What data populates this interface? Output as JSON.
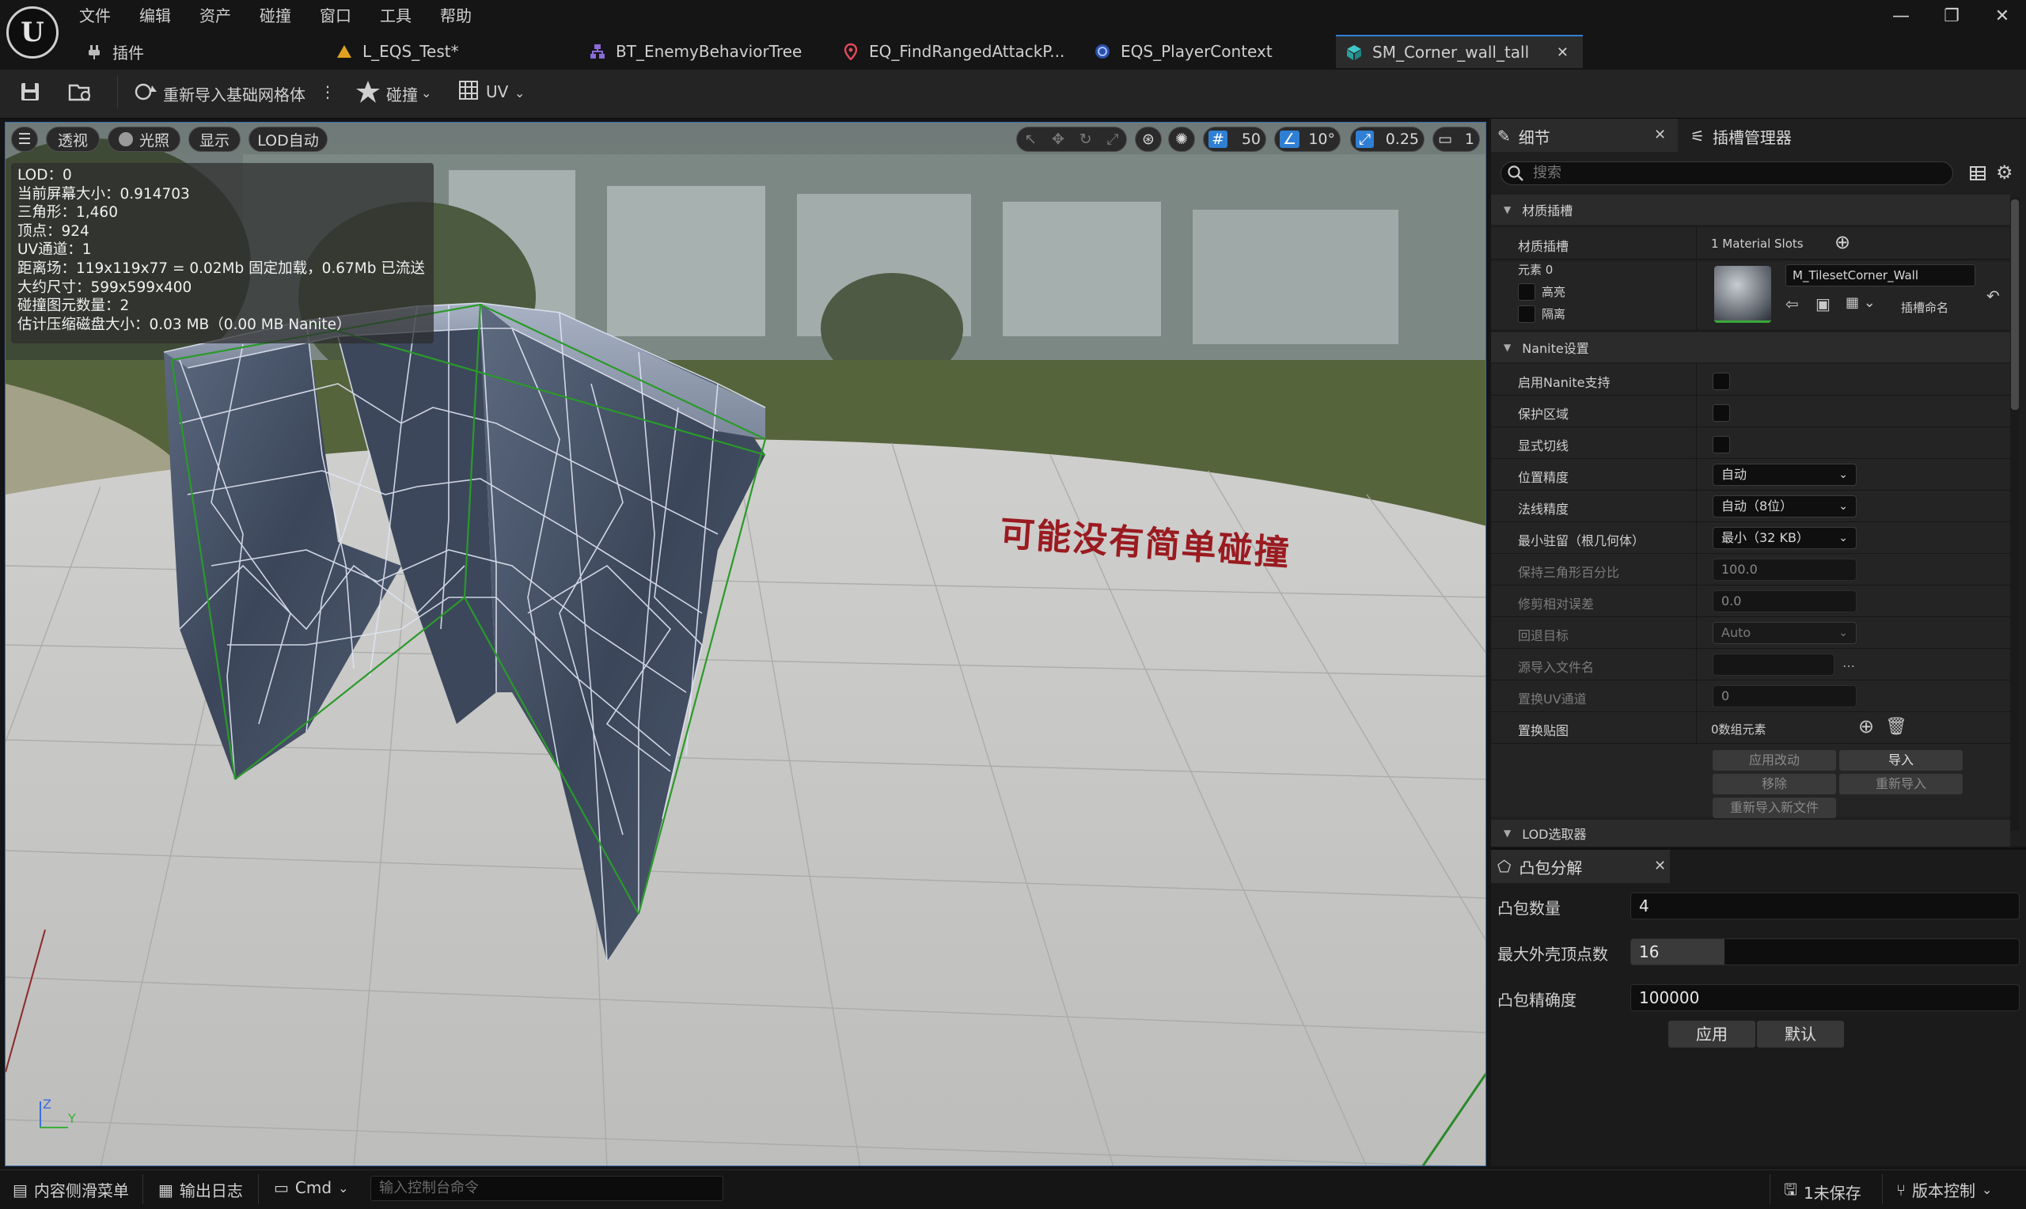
{
  "menu": {
    "items": [
      "文件",
      "编辑",
      "资产",
      "碰撞",
      "窗口",
      "工具",
      "帮助"
    ]
  },
  "logo_text": "U",
  "window_controls": [
    "—",
    "❐",
    "✕"
  ],
  "tabs": [
    {
      "label": "插件"
    },
    {
      "label": "L_EQS_Test*"
    },
    {
      "label": "BT_EnemyBehaviorTree"
    },
    {
      "label": "EQ_FindRangedAttackP..."
    },
    {
      "label": "EQS_PlayerContext"
    },
    {
      "label": "SM_Corner_wall_tall",
      "active": true
    }
  ],
  "tab_close": "✕",
  "toolbar": {
    "reimport_label": "重新导入基础网格体",
    "more": "⋮",
    "collision_label": "碰撞",
    "uv_label": "UV"
  },
  "viewport_bar": {
    "menu": "☰",
    "perspective": "透视",
    "lit": "光照",
    "show": "显示",
    "lod": "LOD自动",
    "grid_value": "50",
    "angle_value": "10°",
    "scale_value": "0.25",
    "camera_speed": "1"
  },
  "stats": [
    "LOD：0",
    "当前屏幕大小：0.914703",
    "三角形：1,460",
    "顶点：924",
    "UV通道：1",
    "距离场：119x119x77 = 0.02Mb 固定加载，0.67Mb 已流送",
    "大约尺寸：599x599x400",
    "碰撞图元数量：2",
    "估计压缩磁盘大小：0.03 MB（0.00 MB Nanite）"
  ],
  "annotation": "可能没有简单碰撞",
  "axis": {
    "z": "Z",
    "y": "Y"
  },
  "details": {
    "tab_label": "细节",
    "socket_tab_label": "插槽管理器",
    "close": "✕",
    "search_placeholder": "搜索",
    "material_section": "材质插槽",
    "material_slots_label": "材质插槽",
    "material_slots_value": "1 Material Slots",
    "element_label": "元素 0",
    "highlight_label": "高亮",
    "isolate_label": "隔离",
    "material_name": "M_TilesetCorner_Wall",
    "slot_name_label": "插槽命名",
    "nanite_section": "Nanite设置",
    "nanite_rows": [
      {
        "label": "启用Nanite支持",
        "kind": "check"
      },
      {
        "label": "保护区域",
        "kind": "check"
      },
      {
        "label": "显式切线",
        "kind": "check"
      },
      {
        "label": "位置精度",
        "kind": "drop",
        "value": "自动"
      },
      {
        "label": "法线精度",
        "kind": "drop",
        "value": "自动（8位）"
      },
      {
        "label": "最小驻留（根几何体）",
        "kind": "drop",
        "value": "最小（32 KB）"
      },
      {
        "label": "保持三角形百分比",
        "kind": "num",
        "value": "100.0",
        "dim": true
      },
      {
        "label": "修剪相对误差",
        "kind": "num",
        "value": "0.0",
        "dim": true
      },
      {
        "label": "回退目标",
        "kind": "drop",
        "value": "Auto",
        "dim": true
      },
      {
        "label": "源导入文件名",
        "kind": "file",
        "dim": true
      },
      {
        "label": "置换UV通道",
        "kind": "num",
        "value": "0",
        "dim": true
      },
      {
        "label": "置换贴图",
        "kind": "array",
        "value": "0数组元素"
      }
    ],
    "buttons": {
      "apply_changes": "应用改动",
      "import": "导入",
      "remove": "移除",
      "reimport": "重新导入",
      "reimport_new": "重新导入新文件"
    },
    "lod_section": "LOD选取器"
  },
  "convex": {
    "title": "凸包分解",
    "close": "✕",
    "hull_count_label": "凸包数量",
    "hull_count": "4",
    "max_verts_label": "最大外壳顶点数",
    "max_verts": "16",
    "max_verts_fraction": 0.24,
    "precision_label": "凸包精确度",
    "precision": "100000",
    "apply": "应用",
    "default": "默认"
  },
  "statusbar": {
    "content_drawer": "内容侧滑菜单",
    "output_log": "输出日志",
    "cmd": "Cmd",
    "cmd_placeholder": "输入控制台命令",
    "unsaved": "1未保存",
    "source_control": "版本控制"
  },
  "colors": {
    "accent": "#2f7fd4",
    "annotation": "#9a1b20",
    "wire": "#2a9a2a"
  }
}
